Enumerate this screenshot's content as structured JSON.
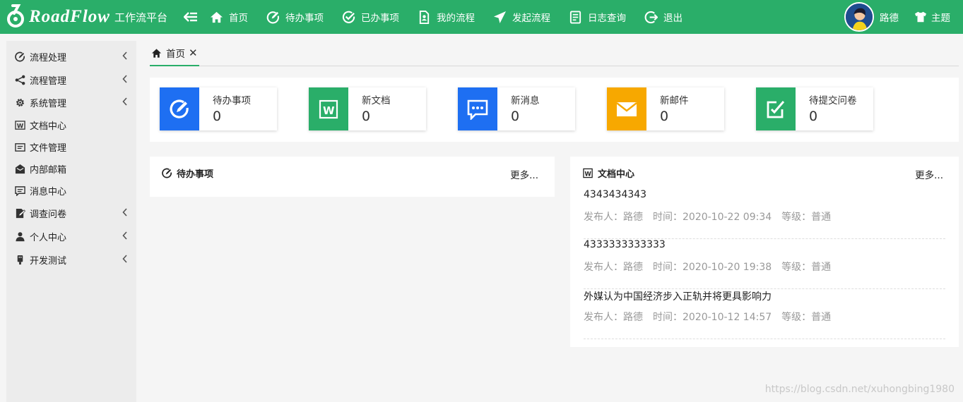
{
  "app": {
    "logo_text": "RoadFlow",
    "subtitle": "工作流平台"
  },
  "topnav": [
    {
      "label": "首页",
      "icon": "home-icon"
    },
    {
      "label": "待办事项",
      "icon": "edit-circle-icon"
    },
    {
      "label": "已办事项",
      "icon": "check-circle-icon"
    },
    {
      "label": "我的流程",
      "icon": "user-document-icon"
    },
    {
      "label": "发起流程",
      "icon": "send-icon"
    },
    {
      "label": "日志查询",
      "icon": "log-icon"
    },
    {
      "label": "退出",
      "icon": "logout-icon"
    }
  ],
  "user": {
    "name": "路德"
  },
  "theme": {
    "label": "主题"
  },
  "sidebar": {
    "items": [
      {
        "label": "流程处理",
        "icon": "edit-circle-icon",
        "has_children": true
      },
      {
        "label": "流程管理",
        "icon": "share-icon",
        "has_children": true
      },
      {
        "label": "系统管理",
        "icon": "gear-icon",
        "has_children": true
      },
      {
        "label": "文档中心",
        "icon": "word-icon",
        "has_children": false
      },
      {
        "label": "文件管理",
        "icon": "folder-icon",
        "has_children": false
      },
      {
        "label": "内部邮箱",
        "icon": "mailbox-icon",
        "has_children": false
      },
      {
        "label": "消息中心",
        "icon": "message-icon",
        "has_children": false
      },
      {
        "label": "调查问卷",
        "icon": "survey-icon",
        "has_children": true
      },
      {
        "label": "个人中心",
        "icon": "user-icon",
        "has_children": true
      },
      {
        "label": "开发测试",
        "icon": "usb-icon",
        "has_children": true
      }
    ]
  },
  "tabs": [
    {
      "label": "首页",
      "icon": "home-icon",
      "closable": true
    }
  ],
  "stats": [
    {
      "label": "待办事项",
      "count": "0",
      "icon": "edit-circle-icon",
      "color": "#1e6ff2"
    },
    {
      "label": "新文档",
      "count": "0",
      "icon": "word-icon",
      "color": "#2aae69"
    },
    {
      "label": "新消息",
      "count": "0",
      "icon": "message-icon",
      "color": "#1e6ff2"
    },
    {
      "label": "新邮件",
      "count": "0",
      "icon": "mail-icon",
      "color": "#f7a800"
    },
    {
      "label": "待提交问卷",
      "count": "0",
      "icon": "checkbox-edit-icon",
      "color": "#2aae69"
    }
  ],
  "todo_panel": {
    "title": "待办事项",
    "more": "更多...",
    "items": []
  },
  "docs_panel": {
    "title": "文档中心",
    "more": "更多...",
    "items": [
      {
        "title": "4343434343",
        "publisher": "发布人：路德",
        "time": "时间：2020-10-22 09:34",
        "level": "等级：普通"
      },
      {
        "title": "4333333333333",
        "publisher": "发布人：路德",
        "time": "时间：2020-10-20 19:38",
        "level": "等级：普通"
      },
      {
        "title": "外媒认为中国经济步入正轨并将更具影响力",
        "publisher": "发布人：路德",
        "time": "时间：2020-10-12 14:57",
        "level": "等级：普通"
      }
    ]
  },
  "watermark": "https://blog.csdn.net/xuhongbing1980",
  "colors": {
    "brand_green": "#2aae69",
    "blue": "#1e6ff2",
    "orange": "#f7a800"
  }
}
